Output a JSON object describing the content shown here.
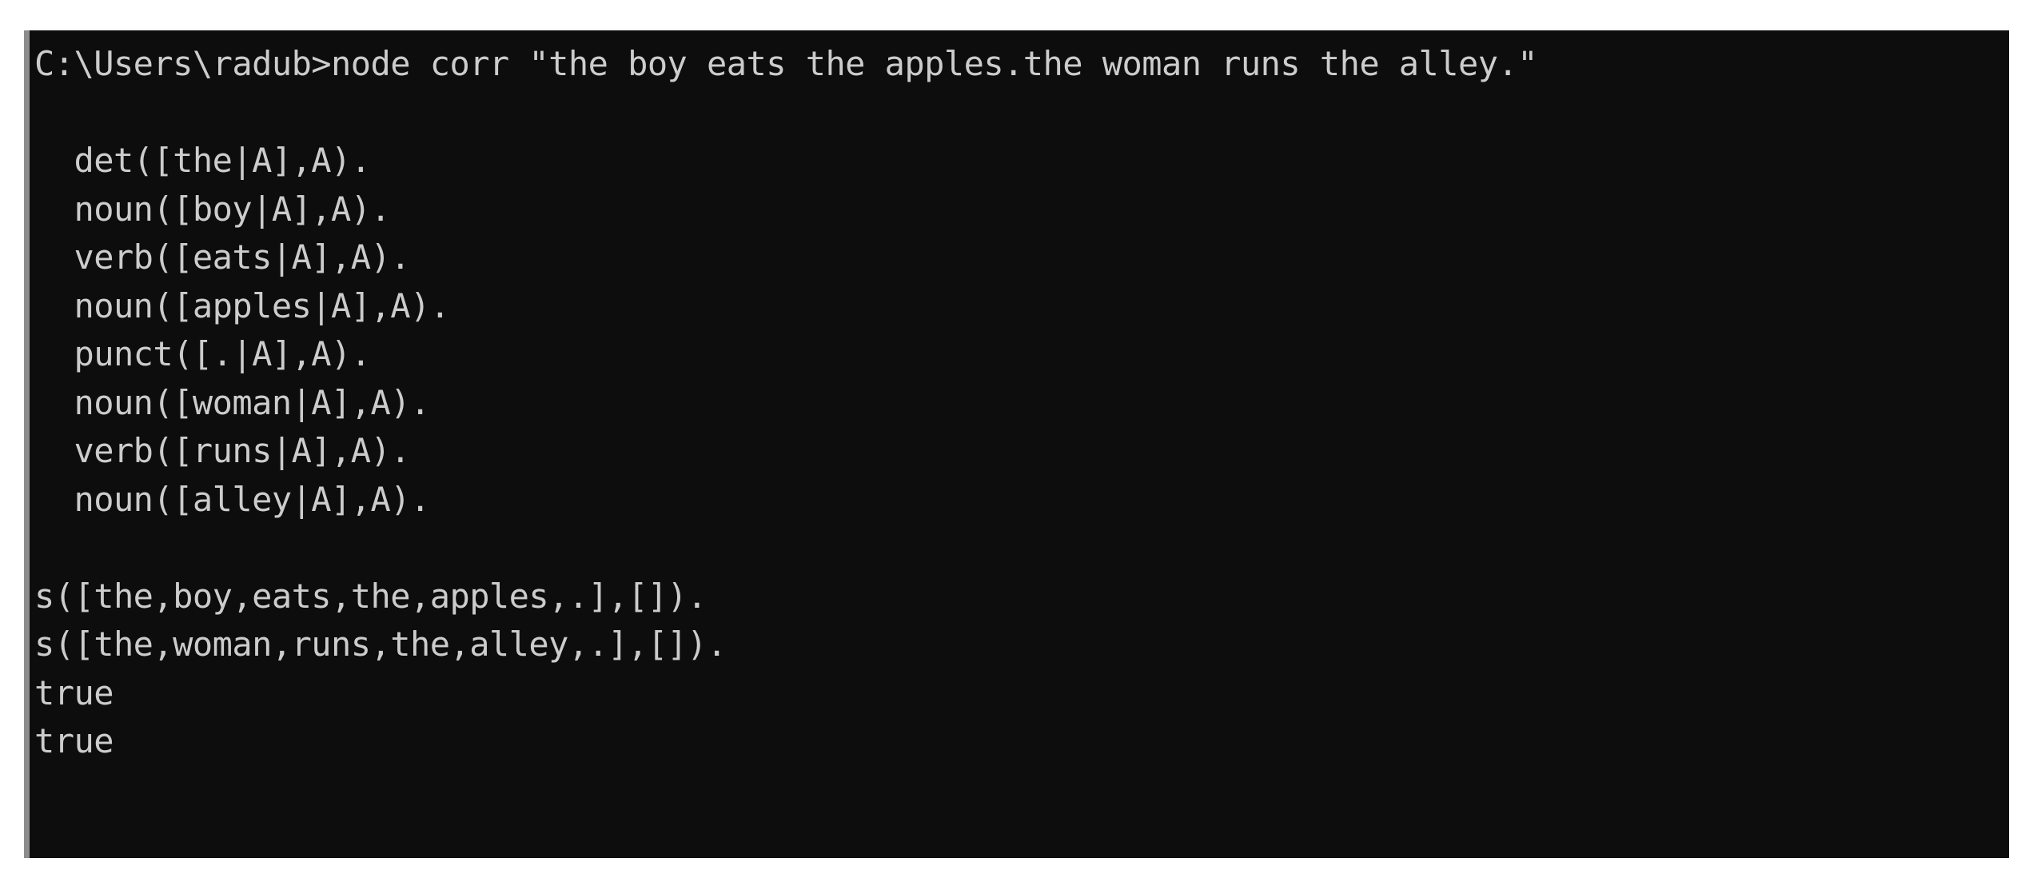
{
  "window": {
    "kind": "windows-command-prompt",
    "background_color": "#0d0d0d",
    "text_color": "#cccccc",
    "border_color": "#8c8c8c",
    "page_background_color": "#ffffff"
  },
  "console": {
    "prompt_path": "C:\\Users\\radub",
    "prompt_symbol": ">",
    "command": "node corr \"the boy eats the apples.the woman runs the alley.\"",
    "command_line": "C:\\Users\\radub>node corr \"the boy eats the apples.the woman runs the alley.\"",
    "lines": [
      "C:\\Users\\radub>node corr \"the boy eats the apples.the woman runs the alley.\"",
      "",
      "  det([the|A],A).",
      "  noun([boy|A],A).",
      "  verb([eats|A],A).",
      "  noun([apples|A],A).",
      "  punct([.|A],A).",
      "  noun([woman|A],A).",
      "  verb([runs|A],A).",
      "  noun([alley|A],A).",
      "",
      "s([the,boy,eats,the,apples,.],[]).",
      "s([the,woman,runs,the,alley,.],[]).",
      "true",
      "true"
    ],
    "lexicon_entries": [
      "  det([the|A],A).",
      "  noun([boy|A],A).",
      "  verb([eats|A],A).",
      "  noun([apples|A],A).",
      "  punct([.|A],A).",
      "  noun([woman|A],A).",
      "  verb([runs|A],A).",
      "  noun([alley|A],A)."
    ],
    "parse_results": [
      "s([the,boy,eats,the,apples,.],[]).",
      "s([the,woman,runs,the,alley,.],[]).",
      "true",
      "true"
    ]
  }
}
